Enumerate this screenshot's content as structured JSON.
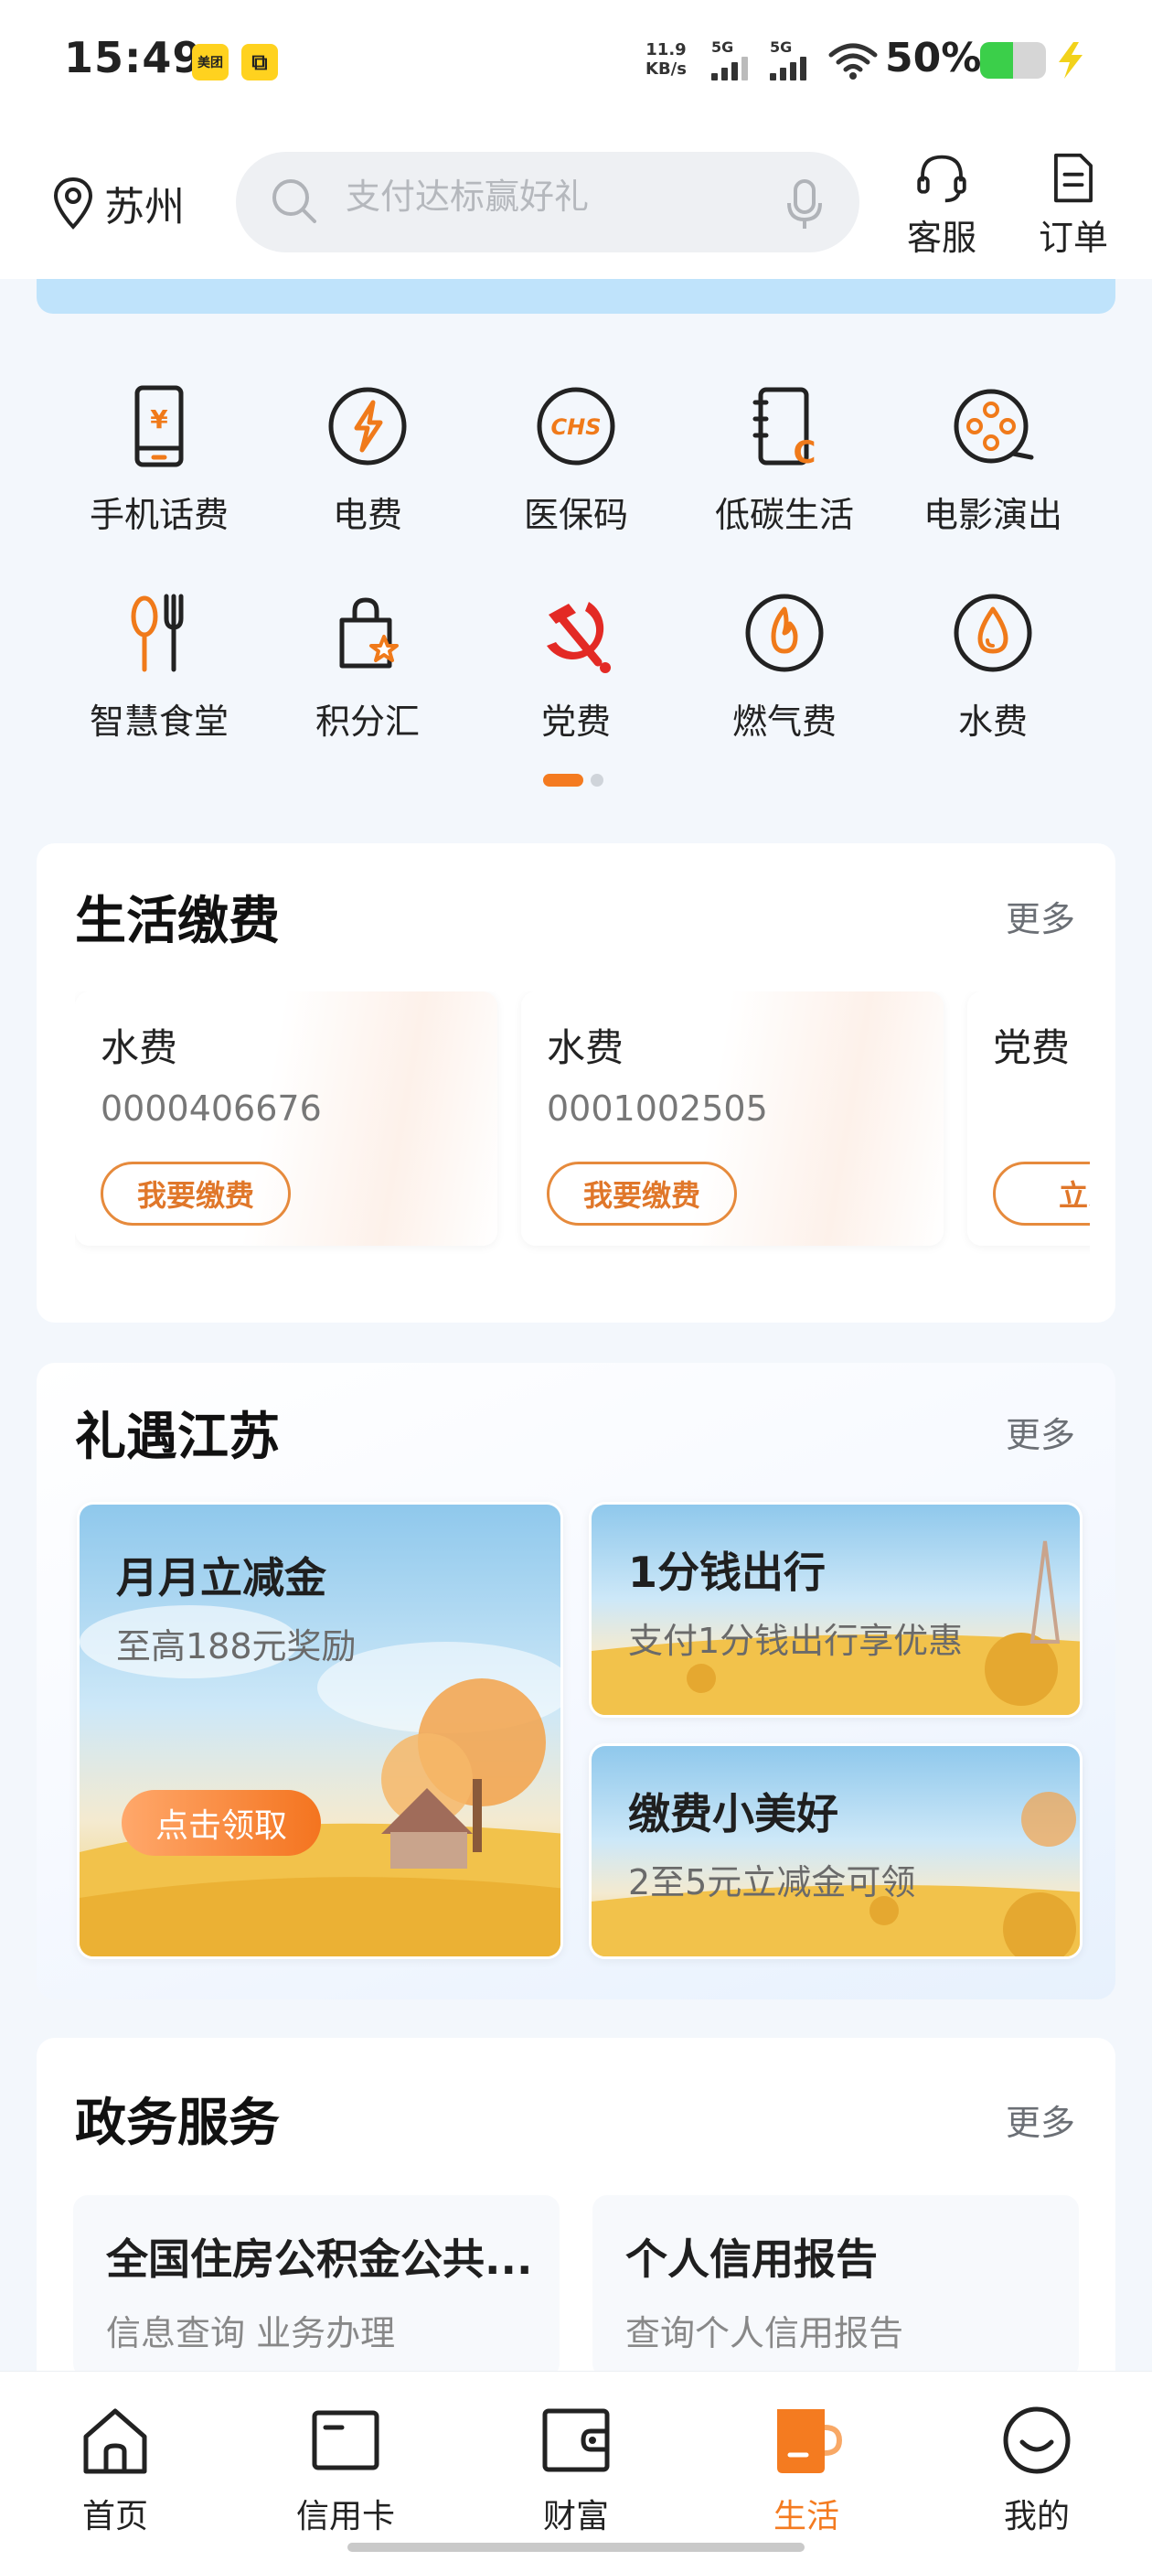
{
  "status_bar": {
    "time": "15:49",
    "app_badges": [
      "美团",
      "⧉"
    ],
    "net_speed_value": "11.9",
    "net_speed_unit": "KB/s",
    "signal_1": "5G",
    "signal_2": "5G",
    "battery_percent": "50%",
    "battery_level": 0.5,
    "icons": [
      "wifi-icon",
      "battery-icon",
      "charging-icon"
    ]
  },
  "header": {
    "location": "苏州",
    "search_placeholder": "支付达标赢好礼",
    "customer_service": "客服",
    "orders": "订单"
  },
  "quick_grid": {
    "items": [
      {
        "label": "手机话费",
        "icon": "phone-bill-icon"
      },
      {
        "label": "电费",
        "icon": "electricity-icon"
      },
      {
        "label": "医保码",
        "icon": "medical-insurance-icon"
      },
      {
        "label": "低碳生活",
        "icon": "low-carbon-icon"
      },
      {
        "label": "电影演出",
        "icon": "movie-reel-icon"
      },
      {
        "label": "智慧食堂",
        "icon": "canteen-icon"
      },
      {
        "label": "积分汇",
        "icon": "points-bag-icon"
      },
      {
        "label": "党费",
        "icon": "party-emblem-icon"
      },
      {
        "label": "燃气费",
        "icon": "gas-flame-icon"
      },
      {
        "label": "水费",
        "icon": "water-drop-icon"
      }
    ],
    "page_count": 2,
    "current_page": 1
  },
  "life_bills": {
    "title": "生活缴费",
    "more": "更多",
    "items": [
      {
        "name": "水费",
        "account": "0000406676",
        "action": "我要缴费"
      },
      {
        "name": "水费",
        "account": "0001002505",
        "action": "我要缴费"
      },
      {
        "name": "党费",
        "account": "",
        "action": "立即"
      }
    ]
  },
  "promotions": {
    "title": "礼遇江苏",
    "more": "更多",
    "main": {
      "title": "月月立减金",
      "subtitle": "至高188元奖励",
      "cta": "点击领取"
    },
    "side": [
      {
        "title": "1分钱出行",
        "subtitle": "支付1分钱出行享优惠"
      },
      {
        "title": "缴费小美好",
        "subtitle": "2至5元立减金可领"
      }
    ]
  },
  "gov_services": {
    "title": "政务服务",
    "more": "更多",
    "items": [
      {
        "title": "全国住房公积金公共...",
        "subtitle": "信息查询 业务办理"
      },
      {
        "title": "个人信用报告",
        "subtitle": "查询个人信用报告"
      }
    ]
  },
  "bottom_nav": {
    "items": [
      {
        "label": "首页",
        "icon": "home-icon"
      },
      {
        "label": "信用卡",
        "icon": "credit-card-icon"
      },
      {
        "label": "财富",
        "icon": "wallet-icon"
      },
      {
        "label": "生活",
        "icon": "coffee-cup-icon"
      },
      {
        "label": "我的",
        "icon": "smiley-icon"
      }
    ],
    "active": "生活"
  },
  "colors": {
    "accent": "#f47b20",
    "icon_orange": "#f07a1a",
    "party_red": "#e32a25",
    "banner_blue": "#bfe3fb",
    "battery_green": "#3bcf4a"
  }
}
